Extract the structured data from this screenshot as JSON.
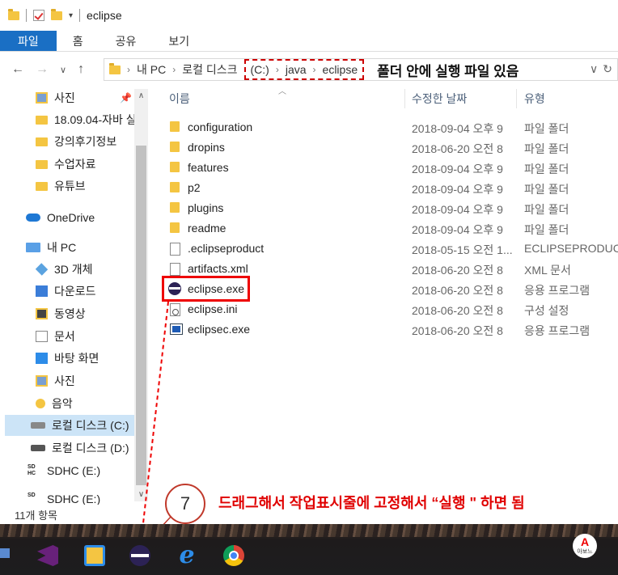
{
  "title_bar": {
    "title": "eclipse"
  },
  "ribbon": {
    "tabs": [
      "파일",
      "홈",
      "공유",
      "보기"
    ]
  },
  "address": {
    "crumbs": [
      "내 PC",
      "로컬 디스크"
    ],
    "highlight_crumbs": [
      "(C:)",
      "java",
      "eclipse"
    ],
    "annotation": "폴더 안에 실행 파일 있음"
  },
  "nav_pane": {
    "items": [
      {
        "label": "사진",
        "icon": "picture-folder-icon"
      },
      {
        "label": "18.09.04-자바 실",
        "icon": "folder-icon"
      },
      {
        "label": "강의후기정보",
        "icon": "folder-icon"
      },
      {
        "label": "수업자료",
        "icon": "folder-icon"
      },
      {
        "label": "유튜브",
        "icon": "folder-icon"
      },
      {
        "label": "OneDrive",
        "icon": "onedrive-icon"
      },
      {
        "label": "내 PC",
        "icon": "pc-icon"
      },
      {
        "label": "3D 개체",
        "icon": "3d-objects-icon"
      },
      {
        "label": "다운로드",
        "icon": "downloads-icon"
      },
      {
        "label": "동영상",
        "icon": "videos-icon"
      },
      {
        "label": "문서",
        "icon": "documents-icon"
      },
      {
        "label": "바탕 화면",
        "icon": "desktop-icon"
      },
      {
        "label": "사진",
        "icon": "pictures-icon"
      },
      {
        "label": "음악",
        "icon": "music-icon"
      },
      {
        "label": "로컬 디스크 (C:)",
        "icon": "drive-icon"
      },
      {
        "label": "로컬 디스크 (D:)",
        "icon": "drive-icon"
      },
      {
        "label": "SDHC (E:)",
        "icon": "sd-card-icon"
      },
      {
        "label": "SDHC (E:)",
        "icon": "sd-card-icon"
      }
    ]
  },
  "file_list": {
    "headers": {
      "name": "이름",
      "date": "수정한 날짜",
      "type": "유형"
    },
    "rows": [
      {
        "name": "configuration",
        "date": "2018-09-04 오후 9",
        "type": "파일 폴더",
        "icon": "folder-icon"
      },
      {
        "name": "dropins",
        "date": "2018-06-20 오전 8",
        "type": "파일 폴더",
        "icon": "folder-icon"
      },
      {
        "name": "features",
        "date": "2018-09-04 오후 9",
        "type": "파일 폴더",
        "icon": "folder-icon"
      },
      {
        "name": "p2",
        "date": "2018-09-04 오후 9",
        "type": "파일 폴더",
        "icon": "folder-icon"
      },
      {
        "name": "plugins",
        "date": "2018-09-04 오후 9",
        "type": "파일 폴더",
        "icon": "folder-icon"
      },
      {
        "name": "readme",
        "date": "2018-09-04 오후 9",
        "type": "파일 폴더",
        "icon": "folder-icon"
      },
      {
        "name": ".eclipseproduct",
        "date": "2018-05-15 오전 1...",
        "type": "ECLIPSEPRODUC",
        "icon": "file-icon"
      },
      {
        "name": "artifacts.xml",
        "date": "2018-06-20 오전 8",
        "type": "XML 문서",
        "icon": "xml-file-icon"
      },
      {
        "name": "eclipse.exe",
        "date": "2018-06-20 오전 8",
        "type": "응용 프로그램",
        "icon": "eclipse-icon"
      },
      {
        "name": "eclipse.ini",
        "date": "2018-06-20 오전 8",
        "type": "구성 설정",
        "icon": "settings-file-icon"
      },
      {
        "name": "eclipsec.exe",
        "date": "2018-06-20 오전 8",
        "type": "응용 프로그램",
        "icon": "console-app-icon"
      }
    ]
  },
  "status": {
    "count": "11개 항목"
  },
  "callout": {
    "number": "7",
    "text": "드래그해서 작업표시줄에 고정해서 “실행 \" 하면 됨"
  },
  "taskbar": {
    "apps": [
      "visual-studio-icon",
      "file-explorer-icon",
      "eclipse-icon",
      "internet-explorer-icon",
      "chrome-icon"
    ],
    "tray_logo_letter": "A",
    "tray_logo_text": "아보느"
  },
  "colors": {
    "ribbon_active": "#1a6fc4",
    "annotation_red": "#e00000",
    "selection": "#cce4f7"
  }
}
